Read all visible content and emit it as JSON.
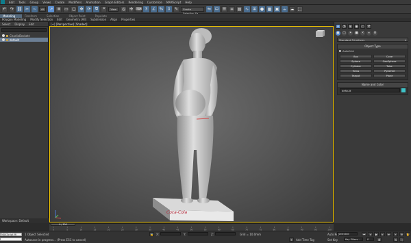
{
  "menubar": {
    "items": [
      "Edit",
      "Tools",
      "Group",
      "Views",
      "Create",
      "Modifiers",
      "Animation",
      "Graph Editors",
      "Rendering",
      "Customize",
      "MAXScript",
      "Help"
    ],
    "workspace": "Workspace: Default"
  },
  "toolbar": {
    "selection_filter": "All",
    "view_dropdown": "View",
    "named_selection": "Create Selection Se"
  },
  "ribbon": {
    "tabs": [
      "Modeling",
      "Freeform",
      "Selection",
      "Object Paint",
      "Populate"
    ],
    "commands": [
      "Polygon Modeling",
      "Modify Selection",
      "Edit",
      "Geometry (All)",
      "Subdivision",
      "Align",
      "Properties"
    ]
  },
  "scene_explorer": {
    "tabs": [
      "Select",
      "Display",
      "Edit"
    ],
    "search_placeholder": "",
    "items": [
      {
        "name": "CharlieBeckett",
        "selected": false
      },
      {
        "name": "default",
        "selected": true
      }
    ],
    "workspace_label": "Workspace: Default"
  },
  "viewport": {
    "label": "[+] [Perspective] [Shaded]",
    "pedestal_text": "Coca-Cola",
    "border_color": "#f0c400"
  },
  "command_panel": {
    "category_dropdown": "Standard Primitives",
    "object_type_header": "Object Type",
    "autogrid_label": "AutoGrid",
    "objects": [
      "Box",
      "Cone",
      "Sphere",
      "GeoSphere",
      "Cylinder",
      "Tube",
      "Torus",
      "Pyramid",
      "Teapot",
      "Plane"
    ],
    "name_color_header": "Name and Color",
    "name_value": "default",
    "swatch_color": "#3ec3c8"
  },
  "timeline": {
    "slider_label": "0 / 100",
    "ticks": [
      "0",
      "5",
      "10",
      "15",
      "20",
      "25",
      "30",
      "35",
      "40",
      "45",
      "50",
      "55",
      "60",
      "65",
      "70",
      "75",
      "80",
      "85",
      "90",
      "95",
      "100"
    ]
  },
  "statusbar": {
    "maxscript_label": "MAXScript Mi",
    "selection_status": "1 Object Selected",
    "prompt": "Autosave in progress... (Press ESC to cancel)",
    "x_label": "X:",
    "y_label": "Y:",
    "z_label": "Z:",
    "grid": "Grid = 10.0mm",
    "add_time_tag": "Add Time Tag",
    "auto_key": "Auto Key",
    "set_key": "Set Key",
    "selected": "Selected",
    "key_filters": "Key Filters...",
    "frame": "0"
  }
}
